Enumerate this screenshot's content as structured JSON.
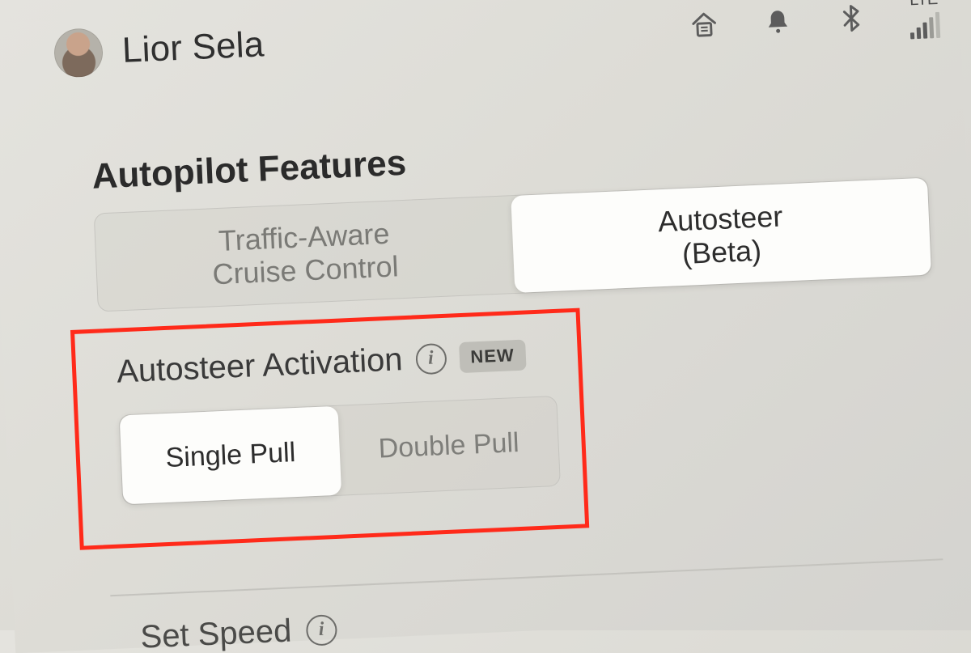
{
  "header": {
    "user_name": "Lior Sela",
    "signal_label": "LTE"
  },
  "section_title": "Autopilot Features",
  "mode_toggle": {
    "options": [
      "Traffic-Aware\nCruise Control",
      "Autosteer\n(Beta)"
    ],
    "selected_index": 1
  },
  "autosteer_activation": {
    "label": "Autosteer Activation",
    "badge": "NEW",
    "options": [
      "Single Pull",
      "Double Pull"
    ],
    "selected_index": 0
  },
  "set_speed": {
    "label": "Set Speed"
  }
}
